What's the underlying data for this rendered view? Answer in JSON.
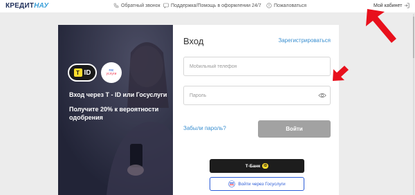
{
  "header": {
    "logo_part1": "КРЕДИТ",
    "logo_part2": "НАУ",
    "links": [
      {
        "label": "Обратный звонок",
        "icon": "phone-icon"
      },
      {
        "label": "Поддержка/Помощь в оформлении 24/7",
        "icon": "chat-icon"
      },
      {
        "label": "Пожаловаться",
        "icon": "complaint-icon"
      }
    ],
    "cabinet": {
      "label": "Мой кабинет",
      "icon": "login-icon"
    }
  },
  "promo": {
    "tid_badge_letter": "T",
    "tid_badge_text": "ID",
    "gos_badge_line1": "гос",
    "gos_badge_line2": "услуги",
    "title": "Вход через Т - ID или Госуслуги",
    "subtitle": "Получите 20% к вероятности одобрения"
  },
  "form": {
    "title": "Вход",
    "register_link": "Зарегистрироваться",
    "phone_placeholder": "Мобильный телефон",
    "password_placeholder": "Пароль",
    "forgot_link": "Забыли пароль?",
    "login_button": "Войти",
    "tbank_button": "Т-Банк",
    "tbank_badge": "ID",
    "gosuslugi_button": "Войти через Госуслуги"
  },
  "colors": {
    "accent": "#3a8fd0",
    "logo_dark": "#1f2f5a",
    "tbank_yellow": "#ffdd2d",
    "gosuslugi_blue": "#2a5bd7",
    "arrow_red": "#e8101c"
  }
}
